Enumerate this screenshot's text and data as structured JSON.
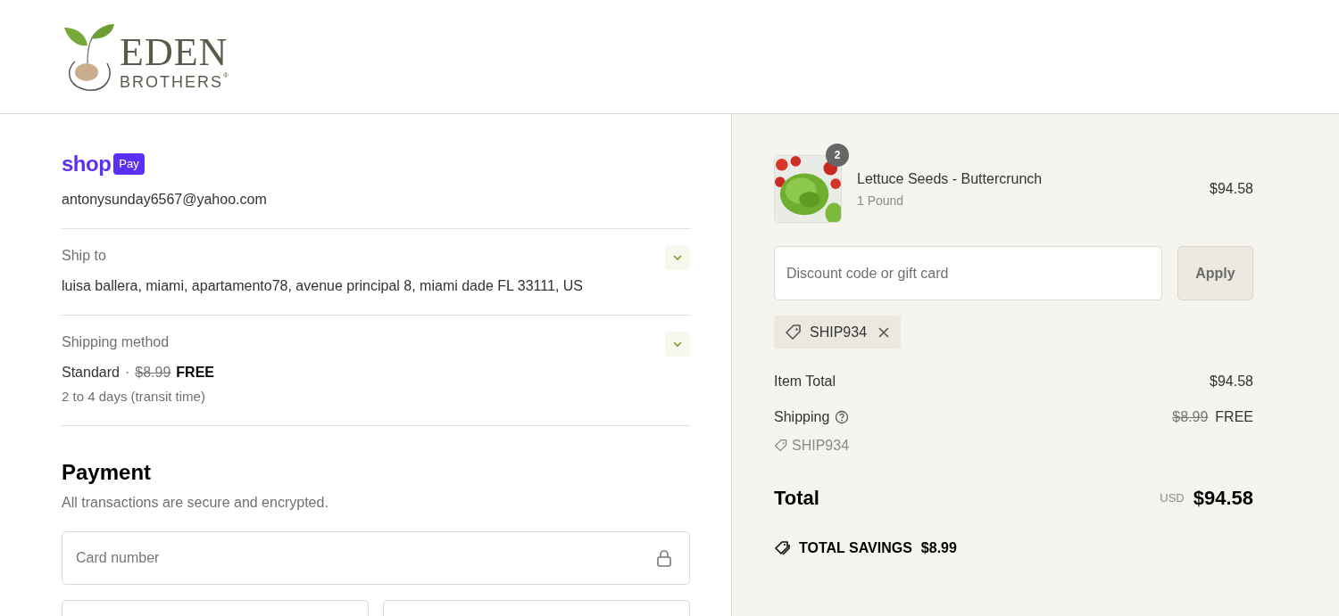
{
  "logo": {
    "line_1": "EDEN",
    "line_2": "BROTHERS",
    "mark": "®"
  },
  "shop_pay": {
    "word": "shop",
    "badge": "Pay",
    "email": "antonysunday6567@yahoo.com"
  },
  "sections": [
    {
      "label": "Ship to",
      "lines": [
        "luisa ballera, miami, apartamento78, avenue principal 8, miami dade FL 33111, US"
      ],
      "expanded": false
    },
    {
      "label": "Shipping method",
      "method": "Standard",
      "separator": "·",
      "old_price": "$8.99",
      "price": "FREE",
      "lines": [
        "2 to 4 days (transit time)"
      ],
      "expanded": false
    }
  ],
  "payment": {
    "title": "Payment",
    "subtitle": "All transactions are secure and encrypted.",
    "card_field": {
      "placeholder": "Card number"
    }
  },
  "cart": {
    "items": [
      {
        "quantity": "2",
        "name": "Lettuce Seeds - Buttercrunch",
        "variant": "1 Pound",
        "price": "$94.58"
      }
    ],
    "discount": {
      "placeholder": "Discount code or gift card",
      "button": "Apply"
    },
    "applied_codes": [
      "SHIP934"
    ],
    "summary": [
      {
        "label": "Item Total",
        "value": "$94.58"
      },
      {
        "label": "Shipping",
        "old_value": "$8.99",
        "value": "FREE",
        "code": "SHIP934"
      }
    ],
    "total": {
      "label": "Total",
      "currency": "USD",
      "value": "$94.58"
    },
    "savings": {
      "label": "TOTAL SAVINGS",
      "value": "$8.99"
    }
  }
}
